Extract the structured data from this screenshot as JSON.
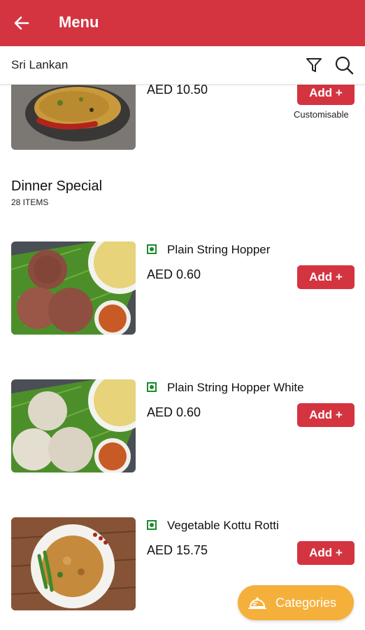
{
  "header": {
    "title": "Menu",
    "back_icon": "back-arrow-icon"
  },
  "subheader": {
    "cuisine": "Sri Lankan",
    "filter_icon": "filter-icon",
    "search_icon": "search-icon"
  },
  "top_item": {
    "price": "AED 10.50",
    "add_label": "Add +",
    "note": "Customisable"
  },
  "section": {
    "title": "Dinner Special",
    "count": "28 ITEMS"
  },
  "items": [
    {
      "name": "Plain String Hopper",
      "price": "AED 0.60",
      "add_label": "Add +",
      "veg": true
    },
    {
      "name": "Plain String Hopper White",
      "price": "AED 0.60",
      "add_label": "Add +",
      "veg": true
    },
    {
      "name": "Vegetable Kottu Rotti",
      "price": "AED 15.75",
      "add_label": "Add +",
      "veg": true
    }
  ],
  "fab": {
    "label": "Categories",
    "icon": "food-tray-icon"
  },
  "colors": {
    "brand": "#d43440",
    "fab": "#f4b03b",
    "veg": "#1d8a2e"
  }
}
